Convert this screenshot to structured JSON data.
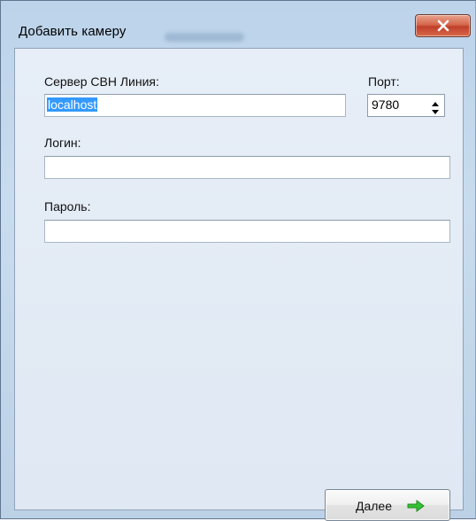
{
  "window": {
    "title": "Добавить камеру",
    "close_icon": "close-x-icon"
  },
  "form": {
    "server_label": "Сервер СВН Линия:",
    "server_value": "localhost",
    "port_label": "Порт:",
    "port_value": "9780",
    "login_label": "Логин:",
    "login_value": "",
    "password_label": "Пароль:",
    "password_value": ""
  },
  "footer": {
    "next_label": "Далее",
    "next_icon": "arrow-right-icon"
  },
  "colors": {
    "selection": "#3399ff",
    "arrow": "#2fb82f",
    "close_button": "#c8472f"
  }
}
